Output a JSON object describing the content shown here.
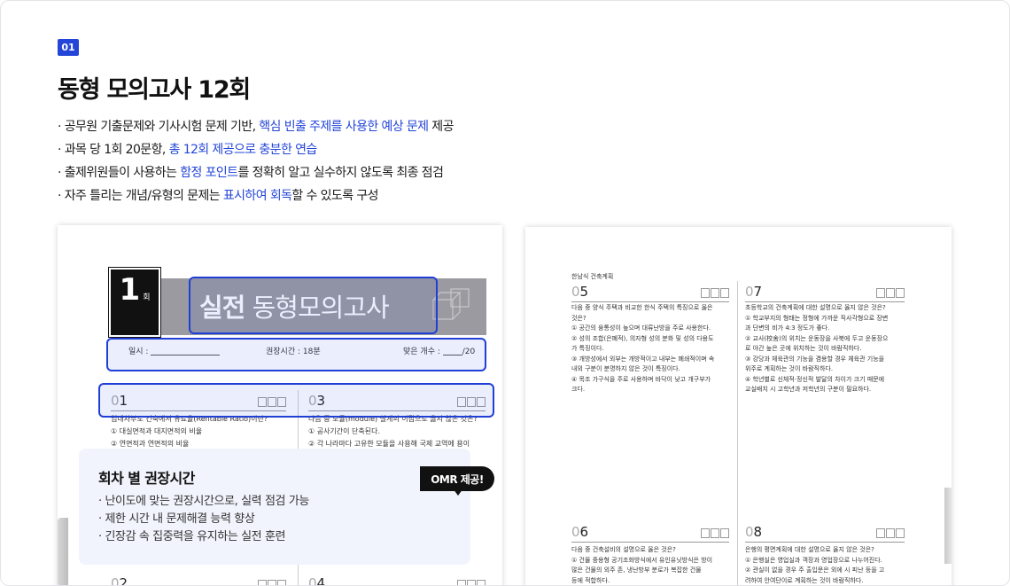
{
  "section": {
    "number": "01",
    "title": "동형 모의고사 12회"
  },
  "bullets": [
    {
      "before": "· 공무원 기출문제와 기사시험 문제 기반, ",
      "highlight": "핵심 빈출 주제를 사용한 예상 문제",
      "after": " 제공"
    },
    {
      "before": "· 과목 당 1회 20문항, ",
      "highlight": "총 12회 제공으로 충분한 연습",
      "after": ""
    },
    {
      "before": "· 출제위원들이 사용하는 ",
      "highlight": "함정 포인트",
      "after": "를 정확히 알고 실수하지 않도록 최종 점검"
    },
    {
      "before": "· 자주 틀리는 개념/유형의 문제는 ",
      "highlight": "표시하여 회독",
      "after": "할 수 있도록 구성"
    }
  ],
  "left_page": {
    "round_number": "1",
    "round_suffix": "회",
    "banner_bold": "실전",
    "banner_rest": " 동형모의고사",
    "date_label": "일시 :",
    "time_label": "권장시간 : 18분",
    "score_label": "맞은 개수 :",
    "score_total": "/20",
    "questions": [
      {
        "zero": "0",
        "num": "1",
        "line1": "임대차부도 건축에서 유료율(Rentable Ratio)이란?",
        "line2": "① 대실면적과 대지면적의 비율",
        "line3": "② 연면적과 연면적의 비율"
      },
      {
        "zero": "0",
        "num": "3",
        "line1": "다음 중 모듈(module) 설계의 이점으로 옳지 않은 것은?",
        "line2": "① 공사기간이 단축된다.",
        "line3": "② 각 나라마다 고유한 모듈을 사용해 국제 교역에 용이"
      },
      {
        "zero": "0",
        "num": "2"
      },
      {
        "zero": "0",
        "num": "4"
      }
    ]
  },
  "info_card": {
    "title": "회차 별 권장시간",
    "items": [
      "· 난이도에 맞는 권장시간으로, 실력 점검 가능",
      "· 제한 시간 내 문제해결 능력 향상",
      "· 긴장감 속 집중력을 유지하는 실전 훈련"
    ]
  },
  "omr_badge": "OMR 제공!",
  "right_page": {
    "header": "한남식 건축계획",
    "questions": [
      {
        "zero": "0",
        "num": "5",
        "lines": [
          "다음 중 양식 주택과 비교한 한식 주택의 특징으로 옳은",
          "것은?",
          "① 공간의 융통성이 높으며 대류난방을 주로 사용한다.",
          "② 성의 조합(은폐적), 의자형 성의 분화 및 성의 다용도",
          "   가 특징이다.",
          "③ 개방성에서 외부는 개방적이고 내부는 폐쇄적이며 속",
          "   내외 구분이 분명하지 않은 것이 특징이다.",
          "④ 목조 가구식을 주로 사용하며 바닥이 낮고 개구부가",
          "   크다."
        ]
      },
      {
        "zero": "0",
        "num": "7",
        "lines": [
          "초등학교의 건축계획에 대한 설명으로 옳지 않은 것은?",
          "① 학교부지의 형태는 정형에 가까운 직사각형으로 장변",
          "   과 단변의 비가 4:3 정도가 좋다.",
          "② 교사(校舍)의 위치는 운동장을 사북에 두고 운동장으",
          "   로 야간 높은 곳에 위치하는 것이 바람직하다.",
          "③ 강당과 체육관의 기능을 겸용할 경우 체육관 기능을",
          "   위주로 계획하는 것이 바람직하다.",
          "④ 학년별로 신체적·정신적 발달의 차이가 크기 때문에",
          "   교실배치 시 고학년과 저학년의 구분이 필요하다."
        ]
      },
      {
        "zero": "0",
        "num": "6",
        "lines": [
          "다음 중 건축설비의 설명으로 옳은 것은?",
          "① 건물 중용형 공기조화방식에서 유인유닛방식은 방이",
          "   많은 건물의 외주 존, 냉난방부 분로가 복잡한 건물",
          "   등에 적합하다."
        ]
      },
      {
        "zero": "0",
        "num": "8",
        "lines": [
          "은행의 평면계획에 대한 설명으로 옳지 않은 것은?",
          "① 은행실은 영업실과 객장과 영업장으로 나누어진다.",
          "② 관실이 없을 경우 주 출입문은 외에 시 피난 등을 고",
          "   려하여 안여단이로 계획하는 것이 바람직하다."
        ]
      }
    ]
  }
}
